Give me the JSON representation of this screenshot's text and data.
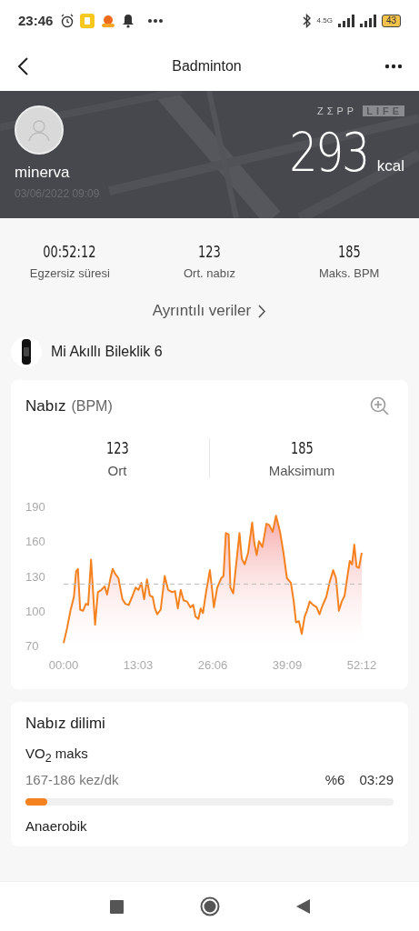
{
  "status_bar": {
    "time": "23:46",
    "network": "4.5G",
    "battery": "43"
  },
  "header": {
    "title": "Badminton"
  },
  "summary": {
    "user": "minerva",
    "datetime": "03/06/2022 09:09",
    "logo_left": "ZΣPP",
    "logo_right": "LIFE",
    "calories": "293",
    "calories_unit": "kcal"
  },
  "stats": [
    {
      "value": "00:52:12",
      "label": "Egzersiz süresi"
    },
    {
      "value": "123",
      "label": "Ort. nabız"
    },
    {
      "value": "185",
      "label": "Maks. BPM"
    }
  ],
  "details_link": "Ayrıntılı veriler",
  "device": "Mi Akıllı Bileklik 6",
  "heart_rate": {
    "title": "Nabız",
    "unit": "(BPM)",
    "stats": [
      {
        "value": "123",
        "label": "Ort"
      },
      {
        "value": "185",
        "label": "Maksimum"
      }
    ],
    "chart_data": {
      "type": "area",
      "x": [
        0,
        0.6,
        1.2,
        1.8,
        2.2,
        2.5,
        2.9,
        3.4,
        3.9,
        4.3,
        4.8,
        5.5,
        6.0,
        6.6,
        7.2,
        7.6,
        8.2,
        8.6,
        9.0,
        9.6,
        10.3,
        10.8,
        11.4,
        12.0,
        12.6,
        13.1,
        13.6,
        14.1,
        14.6,
        15.1,
        15.6,
        16.0,
        16.4,
        17.0,
        17.7,
        18.3,
        19.0,
        19.5,
        20.0,
        20.5,
        21.0,
        21.6,
        22.2,
        22.7,
        23.1,
        23.6,
        24.0,
        24.4,
        24.9,
        25.6,
        26.0,
        26.3,
        26.9,
        27.6,
        28.0,
        28.4,
        28.9,
        29.2,
        29.7,
        30.2,
        30.8,
        31.2,
        31.7,
        32.3,
        33.0,
        33.4,
        33.8,
        34.2,
        34.8,
        35.5,
        36.0,
        36.6,
        37.2,
        37.9,
        38.5,
        39.1,
        39.8,
        40.3,
        40.7,
        41.2,
        41.7,
        42.2,
        42.6,
        43.1,
        43.7,
        44.3,
        44.8,
        45.3,
        46.0,
        46.6,
        47.2,
        47.7,
        48.2,
        48.7,
        49.2,
        49.7,
        50.1,
        50.5,
        50.9,
        51.3,
        51.7,
        52.2
      ],
      "series": [
        {
          "color": "#f5821f",
          "values": [
            72,
            85,
            100,
            112,
            134,
            136,
            101,
            100,
            106,
            105,
            144,
            88,
            116,
            118,
            121,
            114,
            128,
            136,
            132,
            128,
            110,
            106,
            105,
            112,
            120,
            118,
            124,
            110,
            127,
            113,
            112,
            102,
            97,
            101,
            130,
            118,
            116,
            117,
            102,
            118,
            109,
            108,
            103,
            105,
            95,
            93,
            102,
            98,
            115,
            135,
            118,
            103,
            120,
            128,
            130,
            167,
            166,
            120,
            115,
            140,
            167,
            145,
            140,
            150,
            176,
            158,
            148,
            160,
            155,
            175,
            174,
            168,
            182,
            168,
            150,
            128,
            124,
            108,
            90,
            91,
            80,
            95,
            100,
            108,
            105,
            103,
            97,
            104,
            112,
            125,
            135,
            128,
            100,
            108,
            113,
            130,
            143,
            140,
            157,
            138,
            137,
            150
          ]
        }
      ],
      "xlim": [
        0,
        52.2
      ],
      "ylim": [
        70,
        190
      ],
      "xticks": [
        {
          "value": 0,
          "label": "00:00"
        },
        {
          "value": 13.05,
          "label": "13:03"
        },
        {
          "value": 26.1,
          "label": "26:06"
        },
        {
          "value": 39.15,
          "label": "39:09"
        },
        {
          "value": 52.2,
          "label": "52:12"
        }
      ],
      "yticks": [
        70,
        100,
        130,
        160,
        190
      ],
      "ref_lines": [
        {
          "axis": "y",
          "value": 123
        }
      ]
    }
  },
  "zones": {
    "title": "Nabız dilimi",
    "items": [
      {
        "name": "VO$_{2}$ maks",
        "range": "167-186 kez/dk",
        "percent": "%6",
        "time": "03:29",
        "level": 0.06
      },
      {
        "name": "Anaerobik"
      }
    ]
  }
}
